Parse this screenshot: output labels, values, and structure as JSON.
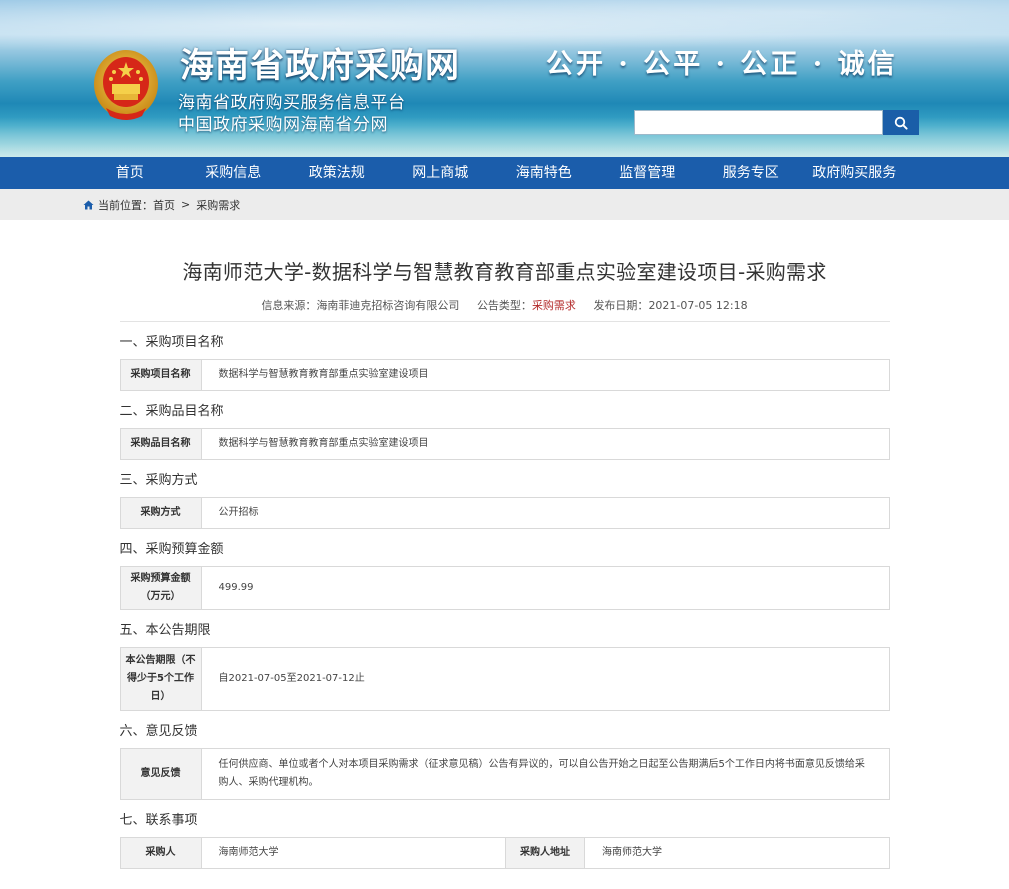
{
  "header": {
    "site_title": "海南省政府采购网",
    "subtitle_1": "海南省政府购买服务信息平台",
    "subtitle_2": "中国政府采购网海南省分网",
    "slogan": "公开 · 公平 · 公正 · 诚信",
    "search_placeholder": ""
  },
  "nav": [
    "首页",
    "采购信息",
    "政策法规",
    "网上商城",
    "海南特色",
    "监督管理",
    "服务专区",
    "政府购买服务"
  ],
  "breadcrumb": {
    "prefix": "当前位置：",
    "home": "首页",
    "sep": ">",
    "current": "采购需求"
  },
  "article": {
    "title": "海南师范大学-数据科学与智慧教育教育部重点实验室建设项目-采购需求",
    "meta": {
      "source_label": "信息来源：",
      "source": "海南菲迪克招标咨询有限公司",
      "type_label": "公告类型：",
      "type": "采购需求",
      "date_label": "发布日期：",
      "date": "2021-07-05 12:18"
    },
    "sections": [
      {
        "heading": "一、采购项目名称",
        "label": "采购项目名称",
        "value": "数据科学与智慧教育教育部重点实验室建设项目"
      },
      {
        "heading": "二、采购品目名称",
        "label": "采购品目名称",
        "value": "数据科学与智慧教育教育部重点实验室建设项目"
      },
      {
        "heading": "三、采购方式",
        "label": "采购方式",
        "value": "公开招标"
      },
      {
        "heading": "四、采购预算金额",
        "label": "采购预算金额（万元）",
        "value": "499.99"
      },
      {
        "heading": "五、本公告期限",
        "label": "本公告期限（不得少于5个工作日）",
        "value": "自2021-07-05至2021-07-12止"
      },
      {
        "heading": "六、意见反馈",
        "label": "意见反馈",
        "value": "任何供应商、单位或者个人对本项目采购需求（征求意见稿）公告有异议的，可以自公告开始之日起至公告期满后5个工作日内将书面意见反馈给采购人、采购代理机构。"
      }
    ],
    "contact": {
      "heading": "七、联系事项",
      "buyer_label": "采购人",
      "buyer": "海南师范大学",
      "addr_label": "采购人地址",
      "addr": "海南师范大学"
    }
  },
  "colors": {
    "nav_bg": "#1b5dab",
    "highlight_red": "#b32a2a",
    "label_bg": "#f2f2f2"
  }
}
